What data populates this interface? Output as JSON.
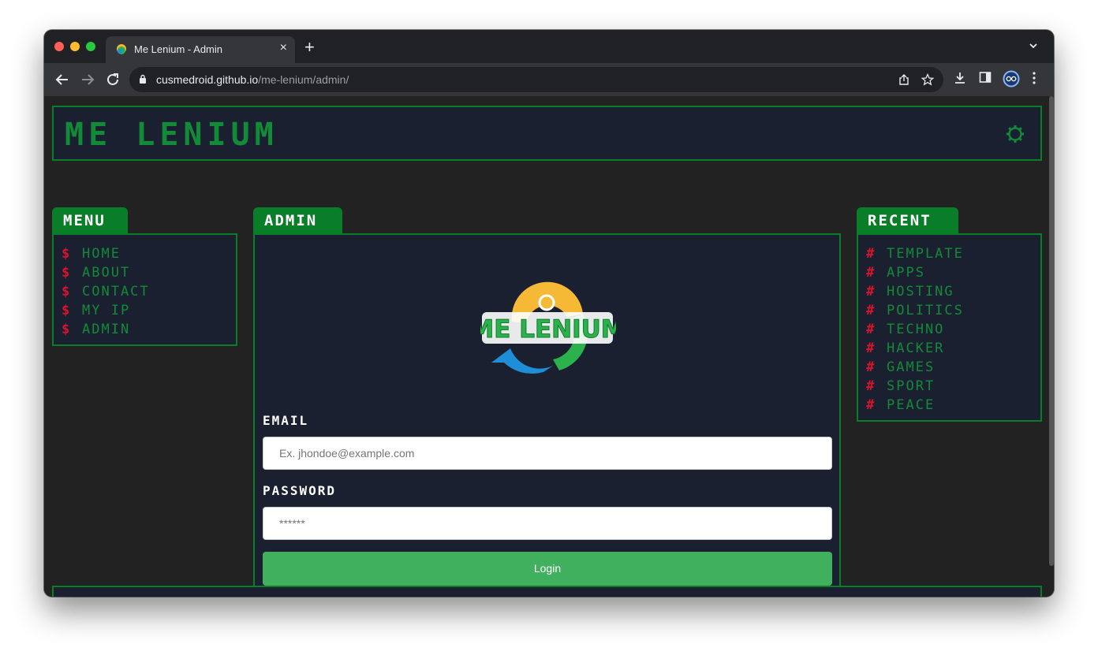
{
  "browser": {
    "tab_title": "Me Lenium - Admin",
    "tab_close": "×",
    "new_tab": "+",
    "url_host": "cusmedroid.github.io",
    "url_path": "/me-lenium/admin/"
  },
  "site": {
    "title": "Me Lenium",
    "logo_text": "ME LENIUM"
  },
  "menu": {
    "heading": "Menu",
    "bullet": "$",
    "items": [
      "Home",
      "About",
      "Contact",
      "My IP",
      "Admin"
    ]
  },
  "admin": {
    "heading": "Admin",
    "email_label": "Email",
    "email_placeholder": "Ex. jhondoe@example.com",
    "password_label": "Password",
    "password_placeholder": "******",
    "login_label": "Login"
  },
  "recent": {
    "heading": "Recent",
    "bullet": "#",
    "items": [
      "Template",
      "Apps",
      "Hosting",
      "Politics",
      "Techno",
      "Hacker",
      "Games",
      "Sport",
      "Peace"
    ]
  },
  "colors": {
    "accent_green": "#0a7d28",
    "text_green": "#128a38",
    "bullet_red": "#d8142c",
    "panel_bg": "#1b2030",
    "button_green": "#40b05e"
  }
}
